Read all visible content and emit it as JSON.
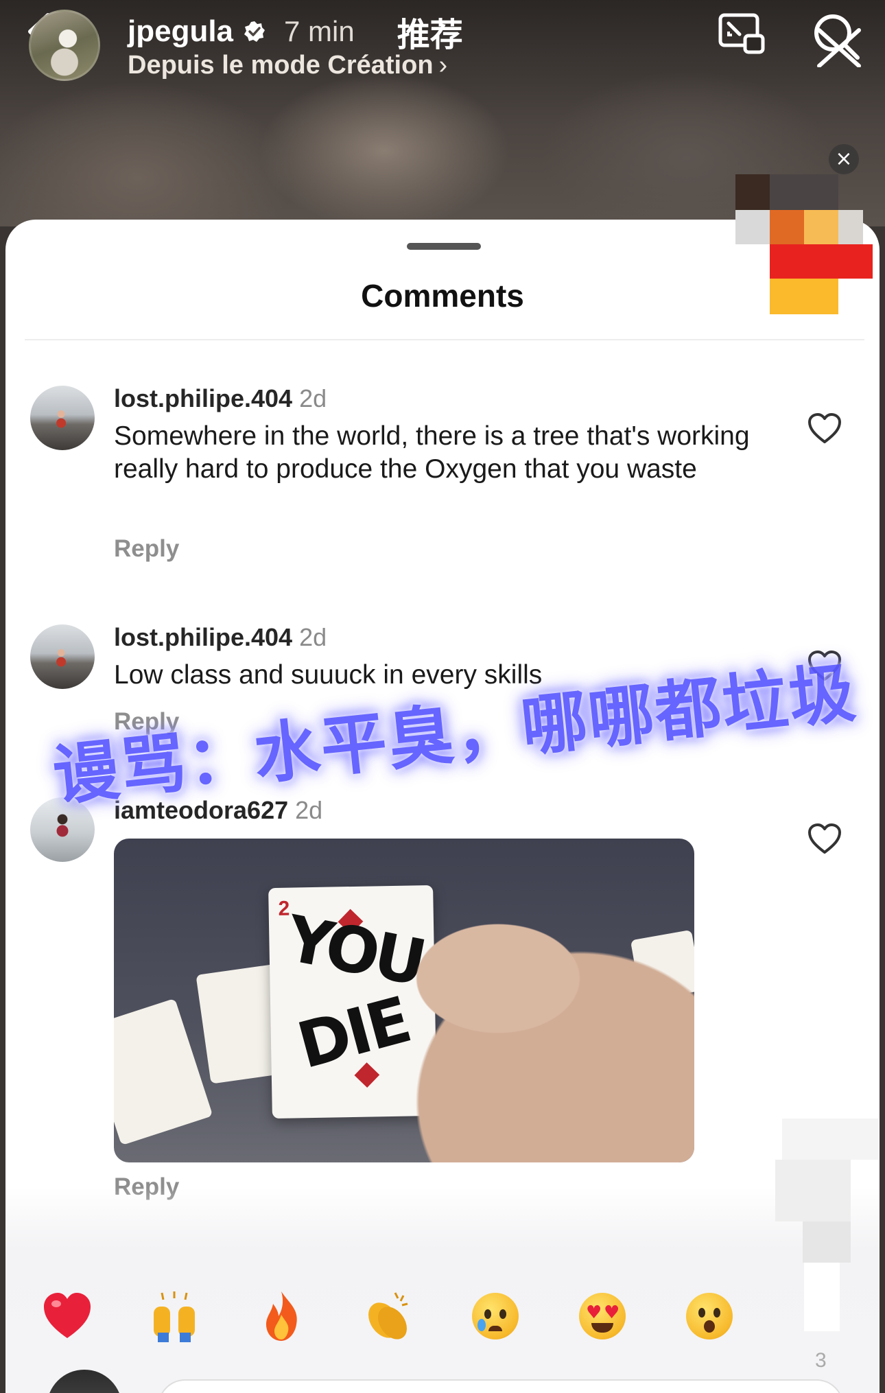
{
  "header": {
    "author": "jpegula",
    "time": "7 min",
    "tab": "推荐",
    "source": "Depuis le mode Création",
    "source_chevron": "›"
  },
  "sheet": {
    "title": "Comments"
  },
  "comments": [
    {
      "user": "lost.philipe.404",
      "age": "2d",
      "text": "Somewhere in the world, there is a tree that's working really hard to produce the Oxygen that you waste",
      "reply": "Reply"
    },
    {
      "user": "lost.philipe.404",
      "age": "2d",
      "text": "Low class and suuuck in every skills",
      "reply": "Reply"
    },
    {
      "user": "iamteodora627",
      "age": "2d",
      "gif": {
        "card_rank": "2",
        "line1": "YOU",
        "line2": "DIE"
      },
      "reply": "Reply"
    }
  ],
  "overlay_caption": "谩骂：水平臭，哪哪都垃圾",
  "emoji_bar": [
    {
      "icon": "red-heart"
    },
    {
      "icon": "raised-hands"
    },
    {
      "icon": "fire"
    },
    {
      "icon": "clapping-hands"
    },
    {
      "icon": "crying-face"
    },
    {
      "icon": "heart-eyes-face"
    },
    {
      "icon": "surprised-face"
    }
  ],
  "page_counter": "3",
  "close_label": "×",
  "colors": {
    "overlay_text": "#5a58ff",
    "reply_gray": "#8e8e8e",
    "heart_red": "#e9203a"
  }
}
